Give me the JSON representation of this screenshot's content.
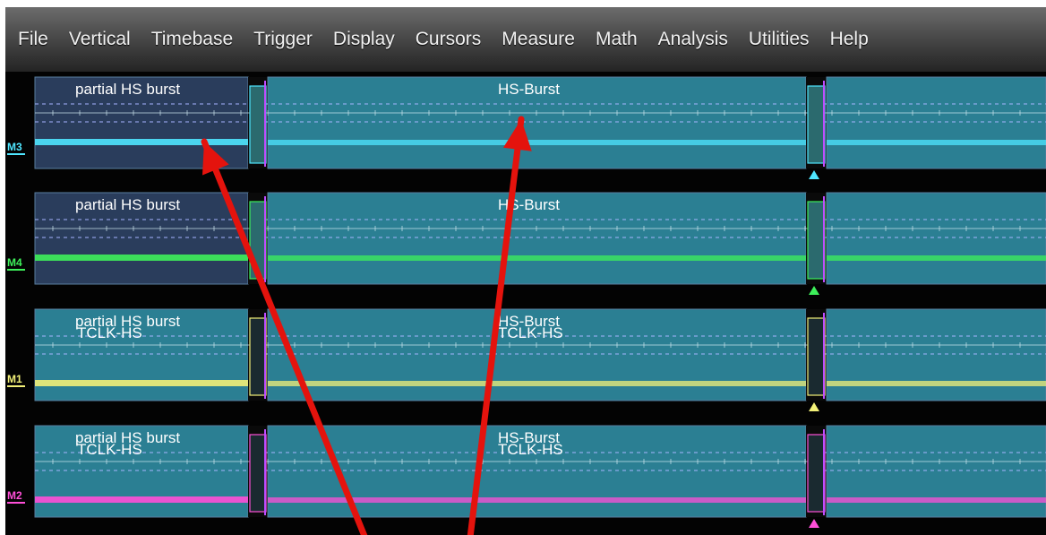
{
  "menu": {
    "items": [
      "File",
      "Vertical",
      "Timebase",
      "Trigger",
      "Display",
      "Cursors",
      "Measure",
      "Math",
      "Analysis",
      "Utilities",
      "Help"
    ]
  },
  "channels": [
    {
      "id": "M3",
      "color": "#4fe6ff",
      "labels": [
        "partial HS burst",
        "HS-Burst"
      ]
    },
    {
      "id": "M4",
      "color": "#3ef05a",
      "labels": [
        "partial HS burst",
        "HS-Burst"
      ]
    },
    {
      "id": "M1",
      "color": "#f2f078",
      "labels": [
        "partial HS burst",
        "HS-Burst"
      ],
      "overlay_labels": [
        "TCLK-HS",
        "TCLK-HS"
      ]
    },
    {
      "id": "M2",
      "color": "#ff4fd8",
      "labels": [
        "partial HS burst",
        "HS-Burst"
      ],
      "overlay_labels": [
        "TCLK-HS",
        "TCLK-HS"
      ]
    }
  ],
  "colors": {
    "panel_background": "#2b7f93",
    "panel_dim_background": "#2c5a72",
    "annotation_arrow": "#e4130d"
  }
}
